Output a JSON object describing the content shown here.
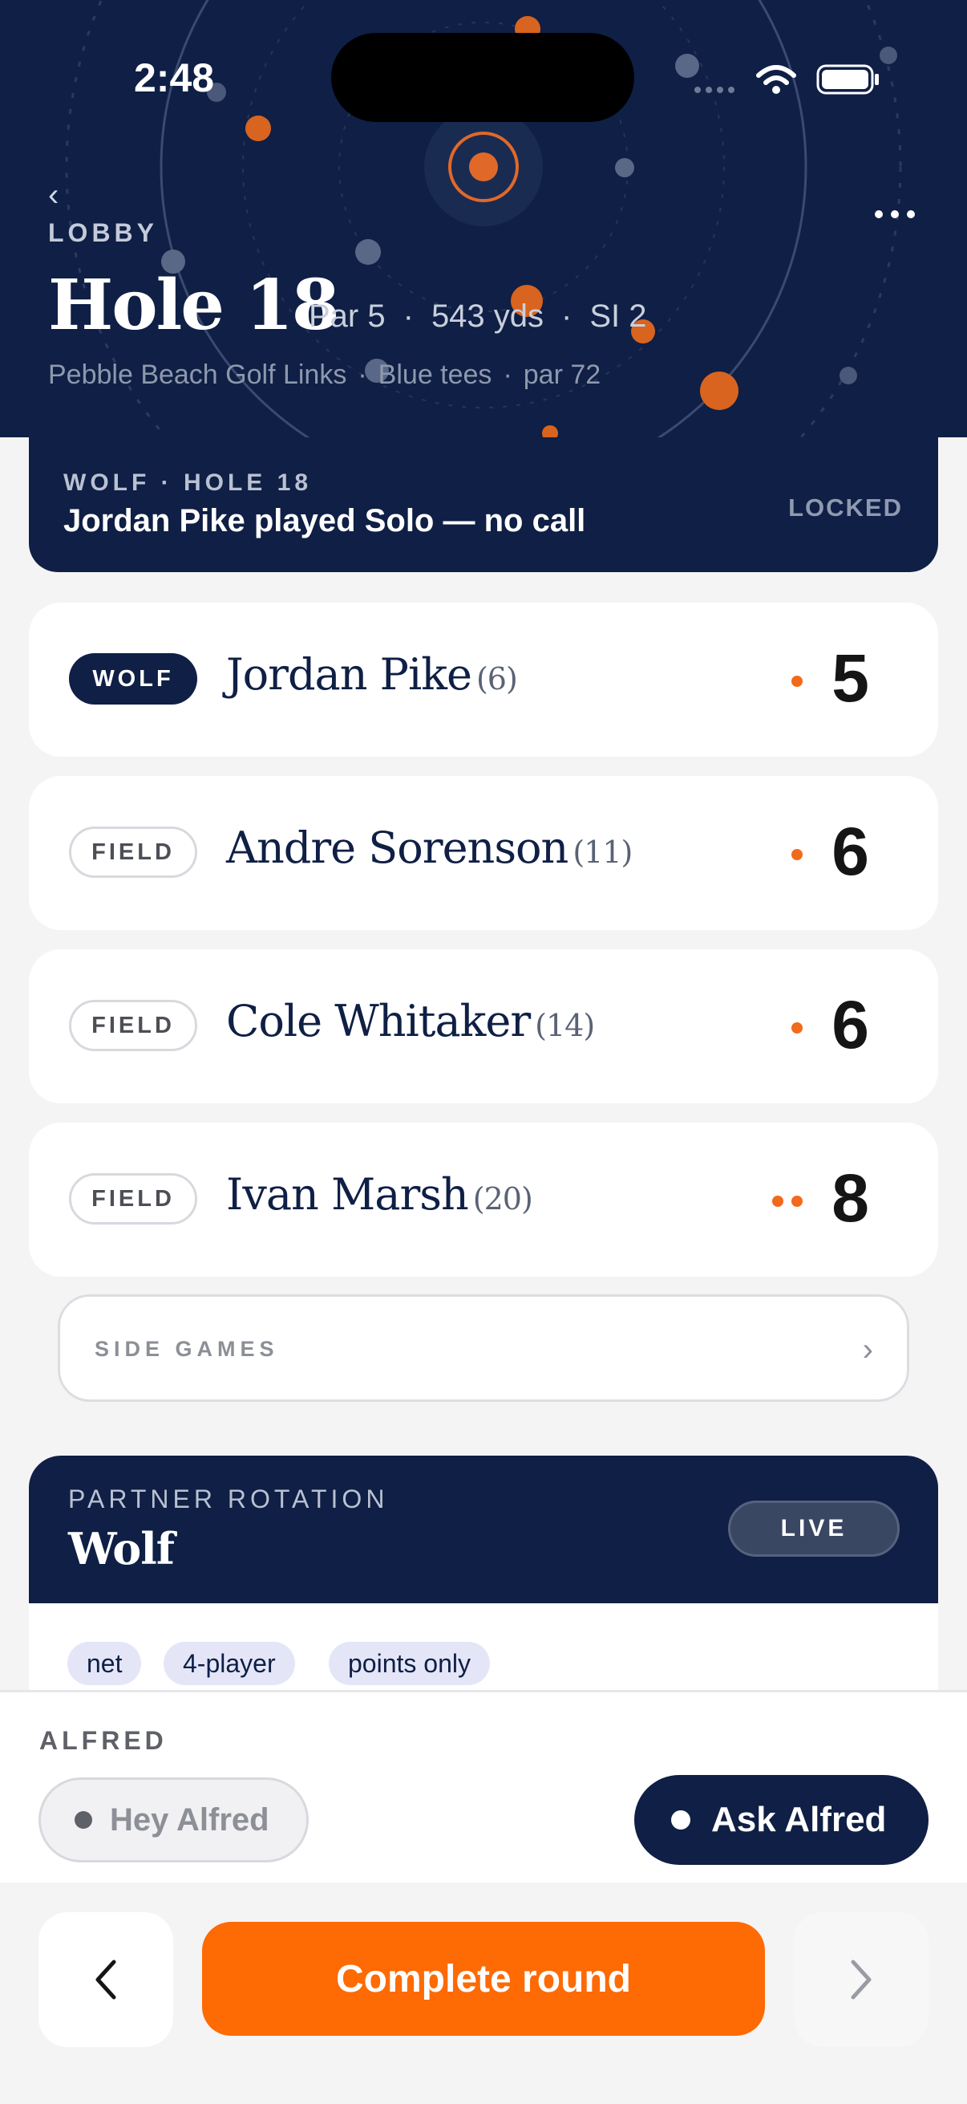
{
  "status_bar": {
    "time": "2:48"
  },
  "header": {
    "back_label": "LOBBY",
    "hole_title": "Hole 18",
    "par": "Par 5",
    "yardage": "543 yds",
    "stroke_index": "SI 2",
    "course": "Pebble Beach Golf Links",
    "tees": "Blue tees",
    "course_par": "par 72",
    "meta_sep": "·"
  },
  "wolf_banner": {
    "kicker": "WOLF · HOLE 18",
    "headline": "Jordan Pike played Solo — no call",
    "status": "LOCKED"
  },
  "players": [
    {
      "role": "WOLF",
      "name": "Jordan Pike",
      "handicap": "(6)",
      "strokes_received": 1,
      "score": "5"
    },
    {
      "role": "FIELD",
      "name": "Andre Sorenson",
      "handicap": "(11)",
      "strokes_received": 1,
      "score": "6"
    },
    {
      "role": "FIELD",
      "name": "Cole Whitaker",
      "handicap": "(14)",
      "strokes_received": 1,
      "score": "6"
    },
    {
      "role": "FIELD",
      "name": "Ivan Marsh",
      "handicap": "(20)",
      "strokes_received": 2,
      "score": "8"
    }
  ],
  "side_games": {
    "label": "SIDE GAMES"
  },
  "rotation": {
    "kicker": "PARTNER ROTATION",
    "game": "Wolf",
    "badge": "LIVE",
    "tags": [
      "net",
      "4-player",
      "points only"
    ]
  },
  "alfred": {
    "title": "ALFRED",
    "hey_label": "Hey Alfred",
    "ask_label": "Ask Alfred"
  },
  "footer": {
    "complete_label": "Complete round"
  },
  "colors": {
    "navy": "#0f1f45",
    "accent": "#fe6a04",
    "stroke_dot": "#f26a1b"
  },
  "icons": {
    "back": "chevron-left-icon",
    "more": "more-horizontal-icon",
    "side_games": "chevron-right-icon",
    "prev": "chevron-left-icon",
    "next": "chevron-right-icon"
  }
}
